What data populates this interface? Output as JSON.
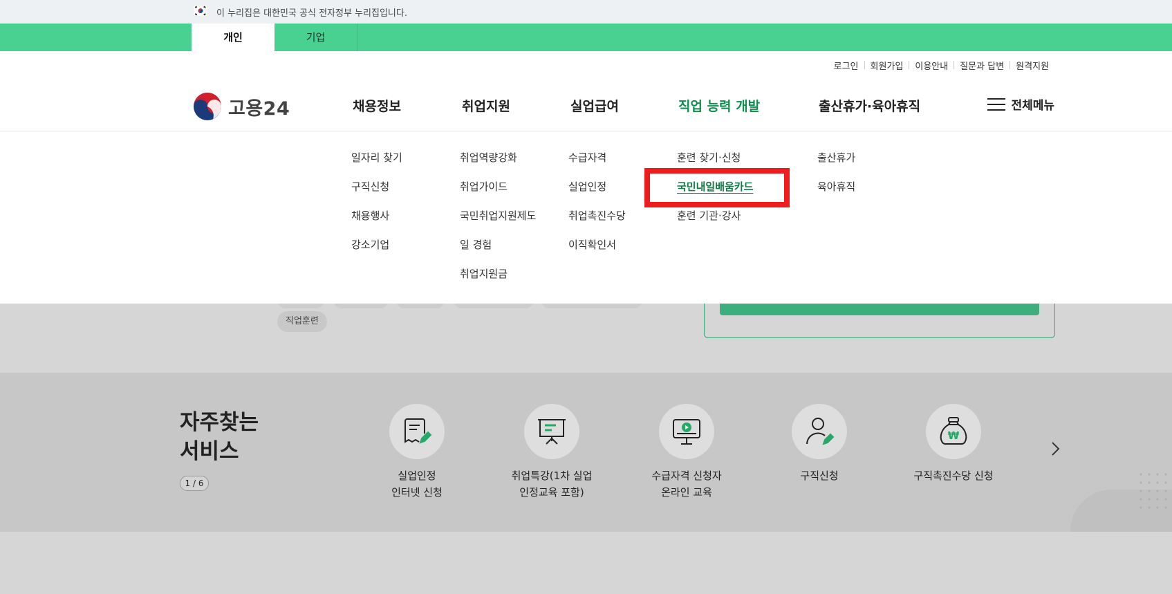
{
  "gov_banner": {
    "text": "이 누리집은 대한민국 공식 전자정부 누리집입니다."
  },
  "audience_tabs": [
    {
      "label": "개인",
      "active": true
    },
    {
      "label": "기업",
      "active": false
    }
  ],
  "util_menu": [
    "로그인",
    "회원가입",
    "이용안내",
    "질문과 답변",
    "원격지원"
  ],
  "logo": {
    "text": "고용24"
  },
  "gnb": [
    {
      "label": "채용정보",
      "sub": [
        "일자리 찾기",
        "구직신청",
        "채용행사",
        "강소기업"
      ]
    },
    {
      "label": "취업지원",
      "sub": [
        "취업역량강화",
        "취업가이드",
        "국민취업지원제도",
        "일 경험",
        "취업지원금"
      ]
    },
    {
      "label": "실업급여",
      "sub": [
        "수급자격",
        "실업인정",
        "취업촉진수당",
        "이직확인서"
      ]
    },
    {
      "label": "직업 능력 개발",
      "active": true,
      "sub": [
        "훈련 찾기·신청",
        "국민내일배움카드",
        "훈련 기관·강사"
      ]
    },
    {
      "label": "출산휴가·육아휴직",
      "sub": [
        "출산휴가",
        "육아휴직"
      ]
    }
  ],
  "all_menu": {
    "label": "전체메뉴"
  },
  "highlighted_item": "국민내일배움카드",
  "background": {
    "chip": "직업훈련",
    "frequent": {
      "title_line1": "자주찾는",
      "title_line2": "서비스",
      "pager": "1 / 6",
      "services": [
        {
          "icon": "document-edit-icon",
          "label": "실업인정\n인터넷 신청"
        },
        {
          "icon": "presentation-icon",
          "label": "취업특강(1차 실업\n인정교육 포함)"
        },
        {
          "icon": "monitor-play-icon",
          "label": "수급자격 신청자\n온라인 교육"
        },
        {
          "icon": "user-edit-icon",
          "label": "구직신청"
        },
        {
          "icon": "money-bag-icon",
          "label": "구직촉진수당 신청"
        }
      ]
    }
  },
  "colors": {
    "brand_green": "#48d190",
    "active_green": "#0f8f4e",
    "highlight_red": "#ee1c1c"
  }
}
